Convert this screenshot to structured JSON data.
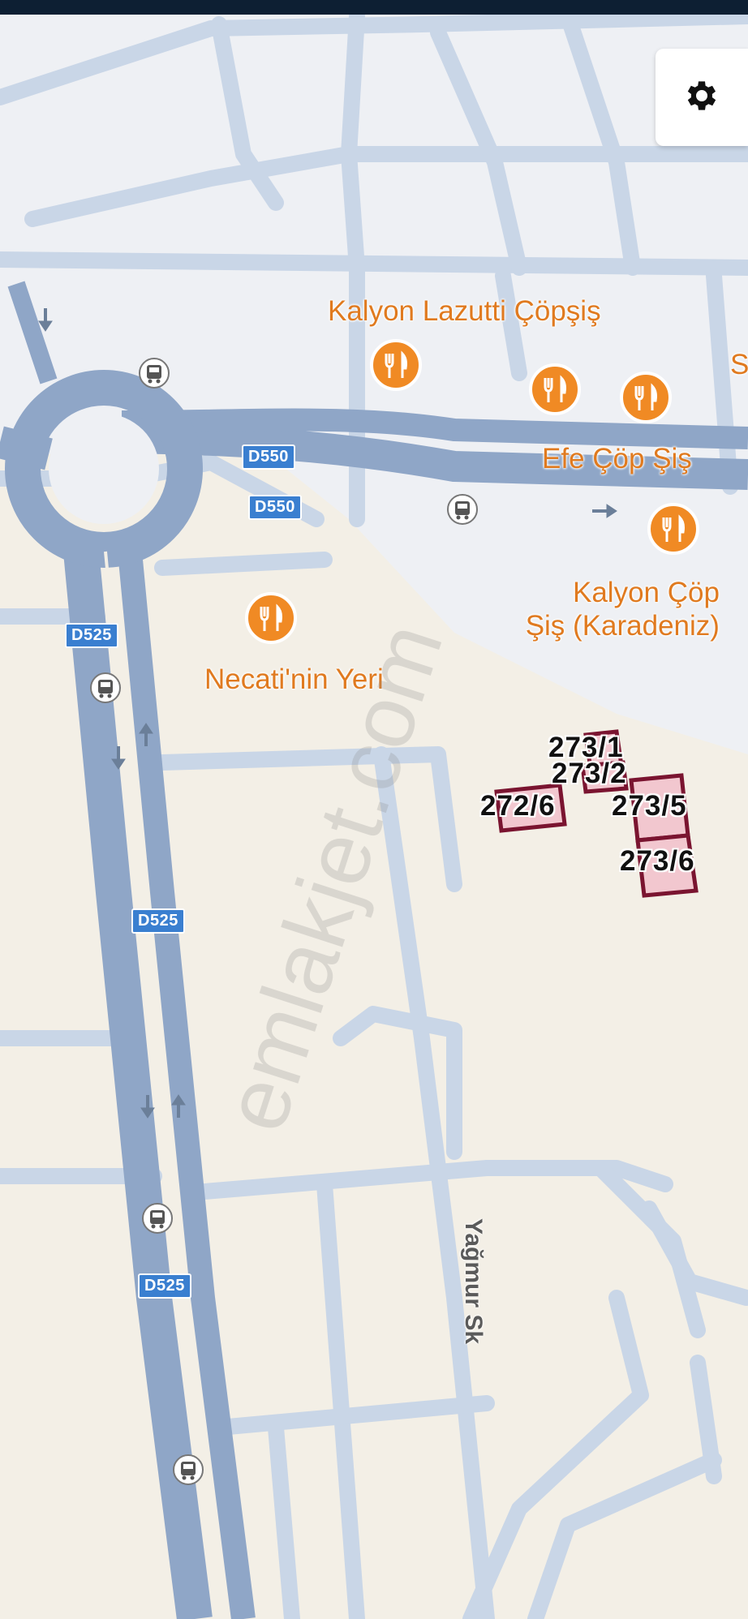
{
  "map": {
    "settings_button": {
      "icon": "gear-icon"
    },
    "road_shields": {
      "d550_a": "D550",
      "d550_b": "D550",
      "d525_a": "D525",
      "d525_b": "D525",
      "d525_c": "D525"
    },
    "places": {
      "kalyon_lazutti": "Kalyon Lazutti Çöpşiş",
      "efe_cop_sis": "Efe Çöp Şiş",
      "kalyon_cop_line1": "Kalyon Çöp",
      "kalyon_cop_line2": "Şiş (Karadeniz)",
      "necati": "Necati'nin Yeri",
      "partial_s": "S"
    },
    "street": "Yağmur Sk",
    "parcels": {
      "p1": "273/1",
      "p2": "273/2",
      "p3": "272/6",
      "p4": "273/5",
      "p5": "273/6"
    },
    "watermark": "emlakjet.com",
    "colors": {
      "land": "#f3efe6",
      "urban": "#eef0f5",
      "highway": "#8fa6c7",
      "minor_road": "#c8d6e8",
      "poi_orange": "#f08a24",
      "parcel_outline": "#7a1430",
      "parcel_fill": "#f2c7cf",
      "shield_blue": "#3a7fd0"
    }
  }
}
